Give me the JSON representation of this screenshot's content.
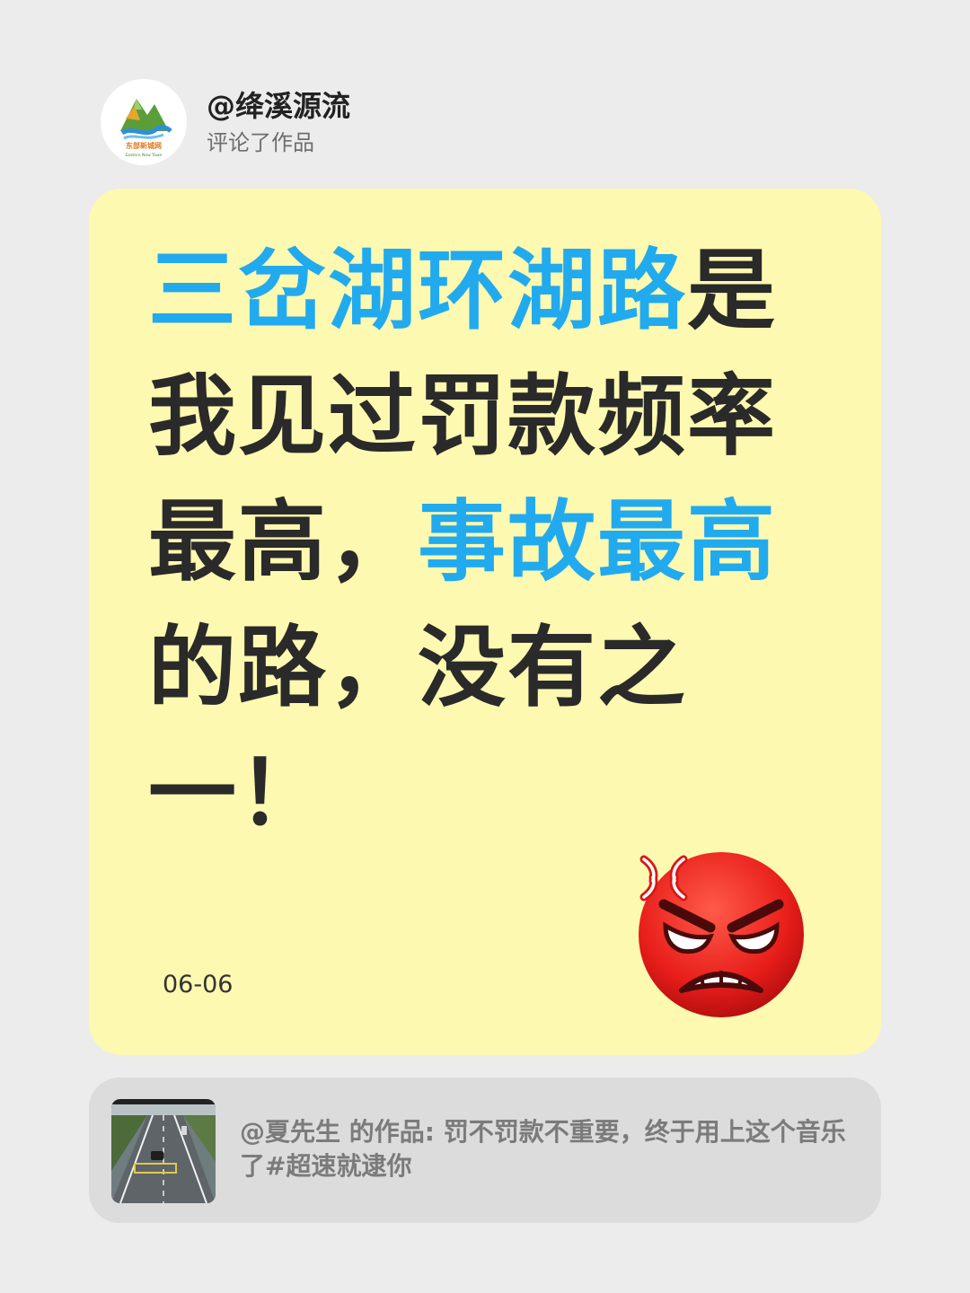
{
  "comment": {
    "username": "@绛溪源流",
    "action": "评论了作品",
    "avatar_icon": "landscape-logo-icon",
    "avatar_logo_text": "东部新城网",
    "avatar_logo_subtext": "Eastern New Town"
  },
  "card": {
    "text_segments": [
      {
        "text": "三岔湖环湖路",
        "highlight": true
      },
      {
        "text": "是我见过罚款频率最高，",
        "highlight": false
      },
      {
        "text": "事故最高",
        "highlight": true
      },
      {
        "text": "的路，没有之一！",
        "highlight": false
      }
    ],
    "date": "06-06",
    "emoji_icon": "angry-face-icon",
    "highlight_color": "#22aaee",
    "text_color": "#2a2a2a",
    "background_color": "#fdf9b0"
  },
  "reference": {
    "thumbnail_icon": "highway-thumbnail",
    "text": "@夏先生  的作品: 罚不罚款不重要，终于用上这个音乐了#超速就逮你"
  }
}
